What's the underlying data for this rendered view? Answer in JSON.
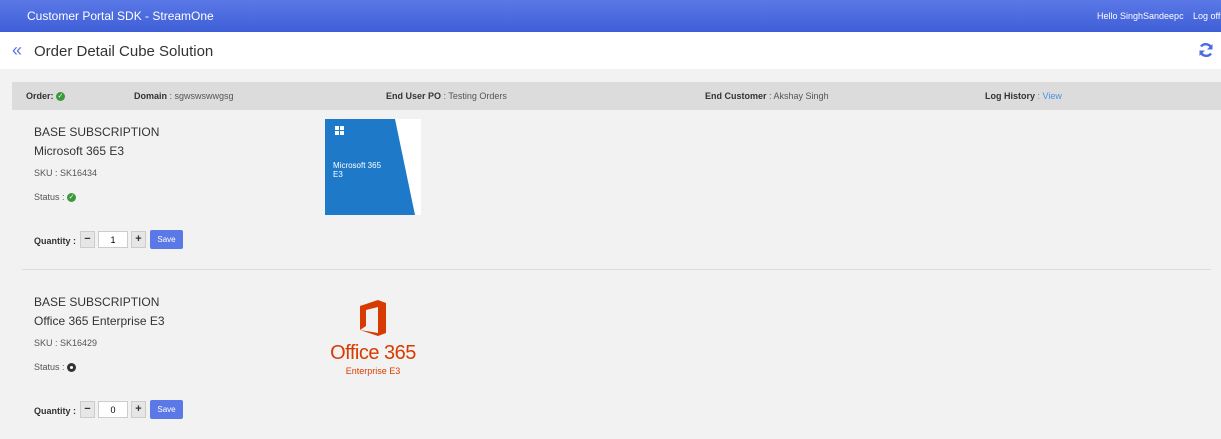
{
  "header": {
    "app_title": "Customer Portal SDK - StreamOne",
    "greeting": "Hello SinghSandeepc",
    "logoff": "Log off"
  },
  "titlebar": {
    "back_icon": "double-chevron-left-icon",
    "title": "Order Detail Cube Solution",
    "refresh_icon": "refresh-icon"
  },
  "order_info": {
    "order_label": "Order:",
    "order_status_icon": "check-circle-icon",
    "domain_label": "Domain",
    "domain_value": ": sgwswswwgsg",
    "end_user_po_label": "End User PO",
    "end_user_po_value": ": Testing Orders",
    "end_customer_label": "End Customer",
    "end_customer_value": ": Akshay Singh",
    "log_history_label": "Log History",
    "log_history_link": ": View"
  },
  "products": [
    {
      "type": "BASE SUBSCRIPTION",
      "name": "Microsoft 365 E3",
      "sku": "SKU : SK16434",
      "status_label": "Status :",
      "status_icon": "check-circle-icon",
      "status_color": "#3a9a3a",
      "quantity_label": "Quantity :",
      "minus": "−",
      "quantity": "1",
      "plus": "+",
      "save": "Save",
      "logo_line1": "Microsoft 365",
      "logo_line2": "E3"
    },
    {
      "type": "BASE SUBSCRIPTION",
      "name": "Office 365 Enterprise E3",
      "sku": "SKU : SK16429",
      "status_label": "Status :",
      "status_icon": "pending-circle-icon",
      "status_color": "#333333",
      "quantity_label": "Quantity :",
      "minus": "−",
      "quantity": "0",
      "plus": "+",
      "save": "Save",
      "logo_line1": "Office 365",
      "logo_line2": "Enterprise E3"
    }
  ],
  "colors": {
    "accent": "#4a6be0",
    "office_orange": "#d83b01",
    "ms365_blue": "#1e7ac8"
  }
}
